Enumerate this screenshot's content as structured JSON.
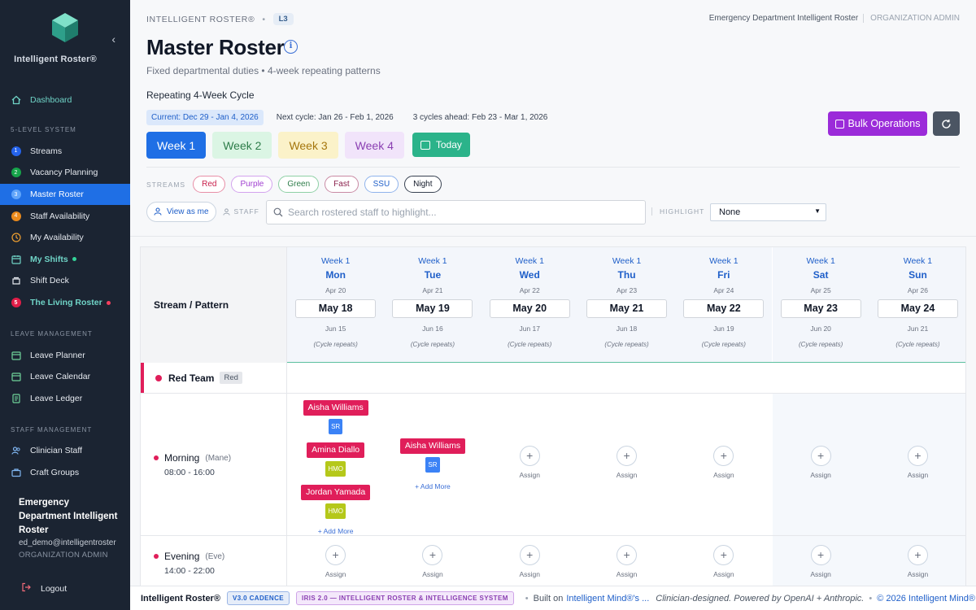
{
  "sidebar": {
    "brand": "Intelligent Roster®",
    "nav": [
      {
        "label": "Dashboard",
        "icon": "home-icon"
      }
    ],
    "section_5level": "5-LEVEL SYSTEM",
    "levels": [
      {
        "num": "1",
        "label": "Streams"
      },
      {
        "num": "2",
        "label": "Vacancy Planning"
      },
      {
        "num": "3",
        "label": "Master Roster"
      },
      {
        "num": "4",
        "label": "Staff Availability"
      }
    ],
    "my_availability": "My Availability",
    "my_shifts": "My Shifts",
    "shift_deck": "Shift Deck",
    "living_num": "5",
    "living_roster": "The Living Roster",
    "section_leave": "LEAVE MANAGEMENT",
    "leave_items": [
      "Leave Planner",
      "Leave Calendar",
      "Leave Ledger"
    ],
    "section_staff": "STAFF MANAGEMENT",
    "staff_items": [
      "Clinician Staff",
      "Craft Groups"
    ],
    "user_org": "Emergency Department Intelligent Roster",
    "user_email": "ed_demo@intelligentroster",
    "user_role": "ORGANIZATION ADMIN",
    "logout": "Logout"
  },
  "header": {
    "crumb_app": "INTELLIGENT ROSTER®",
    "crumb_sep": "•",
    "crumb_level": "L3",
    "org_name": "Emergency Department Intelligent Roster",
    "org_role": "ORGANIZATION ADMIN",
    "title": "Master Roster",
    "info": "i",
    "subtitle": "Fixed departmental duties • 4-week repeating patterns",
    "cycle_heading": "Repeating 4-Week Cycle",
    "cycle_current": "Current: Dec 29 - Jan 4, 2026",
    "cycle_next": "Next cycle: Jan 26 - Feb 1, 2026",
    "cycle_ahead": "3 cycles ahead: Feb 23 - Mar 1, 2026",
    "weeks": [
      "Week 1",
      "Week 2",
      "Week 3",
      "Week 4"
    ],
    "today": "Today",
    "bulk": "Bulk Operations"
  },
  "filters": {
    "streams_label": "STREAMS",
    "streams": [
      "Red",
      "Purple",
      "Green",
      "Fast",
      "SSU",
      "Night"
    ],
    "view_as_me": "View as me",
    "staff_label": "STAFF",
    "search_placeholder": "Search rostered staff to highlight...",
    "highlight_label": "HIGHLIGHT",
    "highlight_value": "None"
  },
  "grid": {
    "corner": "Stream / Pattern",
    "days": [
      {
        "week": "Week 1",
        "day": "Mon",
        "apr": "Apr 20",
        "date": "May 18",
        "jun": "Jun 15",
        "note": "(Cycle repeats)"
      },
      {
        "week": "Week 1",
        "day": "Tue",
        "apr": "Apr 21",
        "date": "May 19",
        "jun": "Jun 16",
        "note": "(Cycle repeats)"
      },
      {
        "week": "Week 1",
        "day": "Wed",
        "apr": "Apr 22",
        "date": "May 20",
        "jun": "Jun 17",
        "note": "(Cycle repeats)"
      },
      {
        "week": "Week 1",
        "day": "Thu",
        "apr": "Apr 23",
        "date": "May 21",
        "jun": "Jun 18",
        "note": "(Cycle repeats)"
      },
      {
        "week": "Week 1",
        "day": "Fri",
        "apr": "Apr 24",
        "date": "May 22",
        "jun": "Jun 19",
        "note": "(Cycle repeats)"
      },
      {
        "week": "Week 1",
        "day": "Sat",
        "apr": "Apr 25",
        "date": "May 23",
        "jun": "Jun 20",
        "note": "(Cycle repeats)"
      },
      {
        "week": "Week 1",
        "day": "Sun",
        "apr": "Apr 26",
        "date": "May 24",
        "jun": "Jun 21",
        "note": "(Cycle repeats)"
      }
    ],
    "team": {
      "name": "Red Team",
      "tag": "Red"
    },
    "morning": {
      "name": "Morning",
      "abbr": "(Mane)",
      "time": "08:00 - 16:00",
      "mon": [
        {
          "name": "Aisha Williams",
          "grade": "SR"
        },
        {
          "name": "Amina Diallo",
          "grade": "HMO"
        },
        {
          "name": "Jordan Yamada",
          "grade": "HMO"
        }
      ],
      "tue": [
        {
          "name": "Aisha Williams",
          "grade": "SR"
        }
      ]
    },
    "evening": {
      "name": "Evening",
      "abbr": "(Eve)",
      "time": "14:00 - 22:00"
    },
    "add_more": "+ Add More",
    "assign": "Assign",
    "plus": "+"
  },
  "footer": {
    "brand": "Intelligent Roster®",
    "badge_version": "V3.0 CADENCE",
    "badge_iris": "IRIS 2.0 — INTELLIGENT ROSTER & INTELLIGENCE SYSTEM",
    "built_on": "Built on",
    "built_link": "Intelligent Mind®'s ...",
    "tagline": "Clinician-designed. Powered by OpenAI + Anthropic.",
    "copyright": "© 2026 Intelligent Mind®"
  }
}
